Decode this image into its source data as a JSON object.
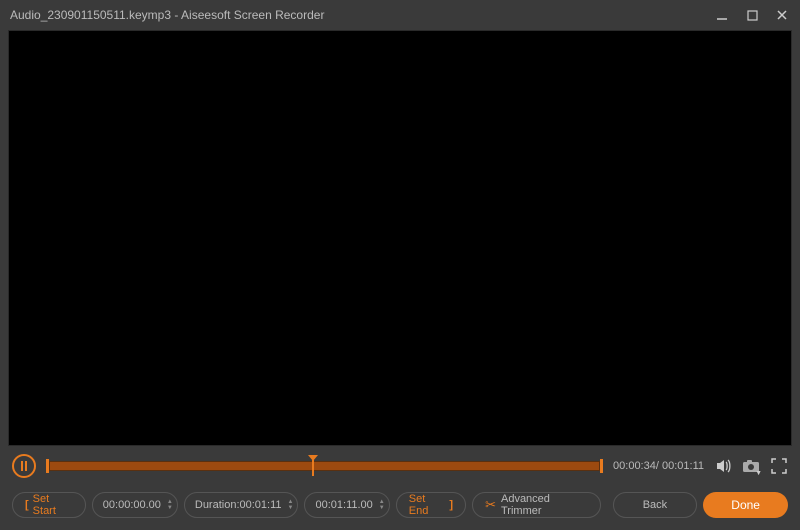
{
  "titlebar": {
    "filename": "Audio_230901150511.keymp3",
    "separator": "  -  ",
    "appname": "Aiseesoft Screen Recorder"
  },
  "playback": {
    "current_time": "00:00:34",
    "total_time": "00:01:11"
  },
  "trimmer": {
    "set_start_label": "Set Start",
    "start_time": "00:00:00.00",
    "duration_label": "Duration:",
    "duration_value": "00:01:11",
    "end_time": "00:01:11.00",
    "set_end_label": "Set End",
    "advanced_label": "Advanced Trimmer",
    "back_label": "Back",
    "done_label": "Done"
  }
}
